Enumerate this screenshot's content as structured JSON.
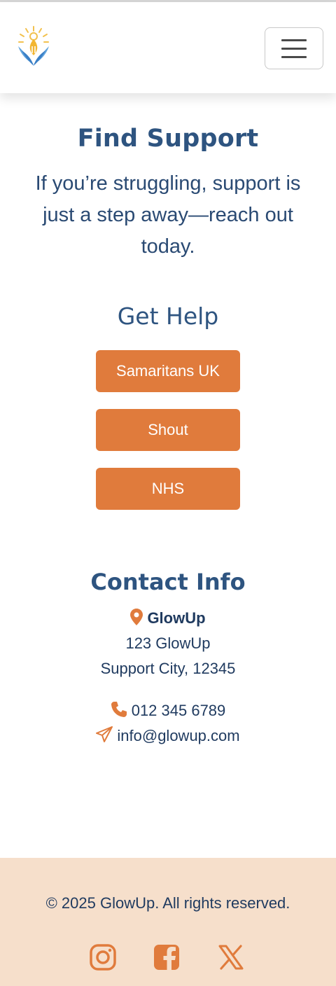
{
  "nav": {
    "logo": "glowup-logo",
    "menu_icon": "hamburger-icon"
  },
  "hero": {
    "title": "Find Support",
    "lead": "If you’re struggling, support is just a step away—reach out today."
  },
  "help": {
    "title": "Get Help",
    "buttons": [
      {
        "label": "Samaritans UK"
      },
      {
        "label": "Shout"
      },
      {
        "label": "NHS"
      }
    ]
  },
  "contact": {
    "title": "Contact Info",
    "org": "GlowUp",
    "address_line1": "123 GlowUp",
    "address_line2": "Support City, 12345",
    "phone": "012 345 6789",
    "email": "info@glowup.com",
    "icons": [
      "map-pin-icon",
      "phone-icon",
      "paper-plane-icon"
    ]
  },
  "footer": {
    "copyright": "© 2025 GlowUp. All rights reserved.",
    "social_icons": [
      "instagram-icon",
      "facebook-icon",
      "x-icon"
    ]
  },
  "colors": {
    "accent": "#e07b3c",
    "heading": "#2e5480",
    "text": "#1f3a5f",
    "footer_bg": "#f6dfcb"
  }
}
